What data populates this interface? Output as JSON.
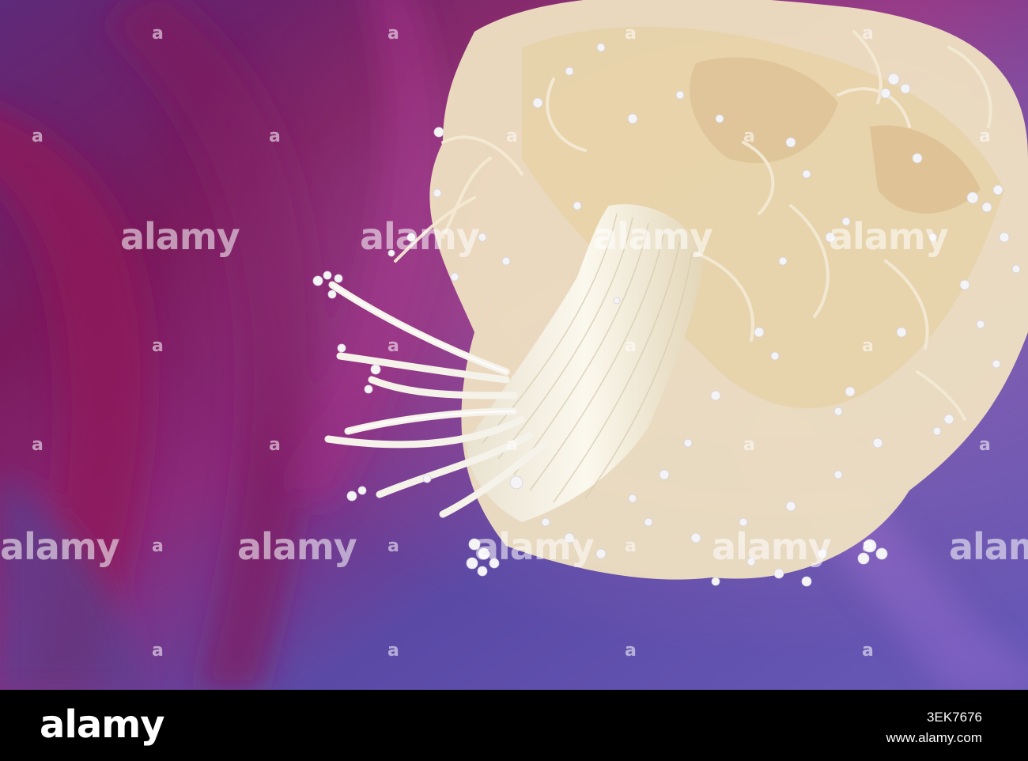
{
  "watermark": {
    "word": "alamy",
    "mark": "a"
  },
  "footer": {
    "logo_text": "alamy",
    "image_id": "3EK7676",
    "site": "www.alamy.com"
  },
  "colors": {
    "background_magenta": "#7a1f6a",
    "background_violet": "#6a4fb4",
    "stamen_cream": "#f1e6cc",
    "pollen_white": "#f4f4f6"
  }
}
